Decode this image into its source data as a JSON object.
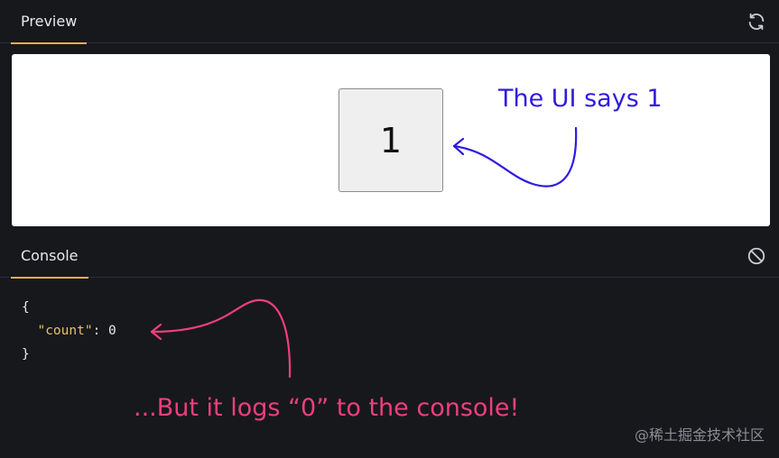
{
  "preview_tab": {
    "label": "Preview",
    "refresh_icon": "refresh-icon"
  },
  "preview": {
    "counter_value": "1"
  },
  "console_tab": {
    "label": "Console",
    "clear_icon": "clear-console-icon"
  },
  "console": {
    "open_brace": "{",
    "key": "\"count\"",
    "separator": ": ",
    "value": "0",
    "close_brace": "}"
  },
  "annotations": {
    "ui_note": "The UI says 1",
    "console_note": "...But it logs “0” to the console!"
  },
  "watermark": "@稀土掘金技术社区",
  "colors": {
    "accent_tab": "#e3b341",
    "ui_note": "#2f1be0",
    "console_note": "#ee3f7c",
    "json_key": "#e8c16a"
  }
}
